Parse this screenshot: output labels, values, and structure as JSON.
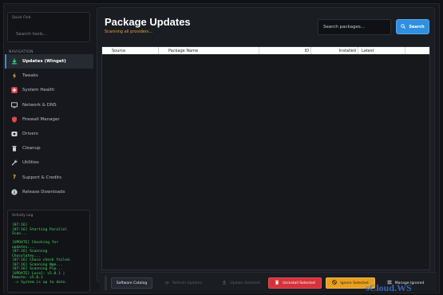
{
  "sidebar": {
    "quick_find": {
      "label": "Quick Find",
      "placeholder": "Search tools..."
    },
    "nav_title": "NAVIGATION",
    "items": [
      {
        "label": "Updates (Winget)",
        "icon": "download-icon",
        "color": "#3ddc84"
      },
      {
        "label": "Tweaks",
        "icon": "lightning-icon",
        "color": "#f5c542"
      },
      {
        "label": "System Health",
        "icon": "plus-icon",
        "color": "#e54848"
      },
      {
        "label": "Network & DNS",
        "icon": "monitor-icon",
        "color": "#d0d4da"
      },
      {
        "label": "Firewall Manager",
        "icon": "shield-icon",
        "color": "#e54848"
      },
      {
        "label": "Drivers",
        "icon": "drive-icon",
        "color": "#d0d4da"
      },
      {
        "label": "Cleanup",
        "icon": "trash-icon",
        "color": "#d0d4da"
      },
      {
        "label": "Utilities",
        "icon": "wrench-icon",
        "color": "#d0d4da"
      },
      {
        "label": "Support & Credits",
        "icon": "question-icon",
        "color": "#f5c542"
      },
      {
        "label": "Release Downloads",
        "icon": "info-icon",
        "color": "#d0d4da"
      }
    ],
    "activity": {
      "label": "Activity Log",
      "log": "[07:16]\n[07:16] Starting Parallel\nScan...\n\n[UPDATE] Checking for\nupdates...\n[07:16] Scanning\nChocolatey...\n[07:16] Choco check failed.\n[07:16] Scanning Npm...\n[07:16] Scanning Pip...\n[UPDATE] Local: v5.0.1 |\nRemote: v5.0.1\n -> System is up to date."
    }
  },
  "main": {
    "title": "Package Updates",
    "subtitle": "Scanning all providers...",
    "search": {
      "placeholder": "Search packages...",
      "button_label": "Search"
    },
    "table": {
      "columns": [
        "Source",
        "Package Name",
        "ID",
        "Installed",
        "Latest"
      ],
      "rows": []
    }
  },
  "footer": {
    "catalog": "Software Catalog",
    "refresh": "Refresh Updates",
    "update": "Update Selected",
    "uninstall": "Uninstall Selected",
    "ignore": "Ignore Selected",
    "manage": "Manage Ignored"
  },
  "watermark": "sCloud.WS",
  "colors": {
    "accent": "#2f8fe0",
    "danger": "#d6323a",
    "warning": "#e8a021",
    "log": "#4cd964"
  }
}
